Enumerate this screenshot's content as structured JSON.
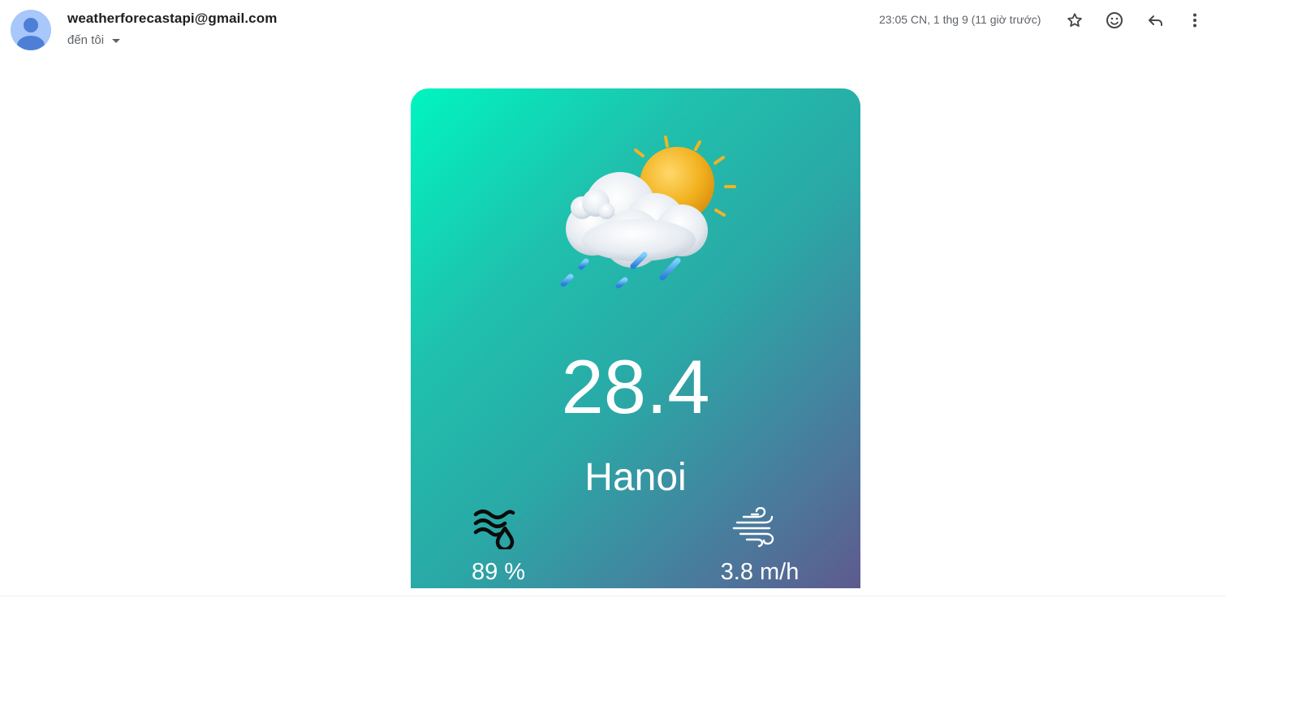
{
  "email": {
    "sender": "weatherforecastapi@gmail.com",
    "recipient_label": "đến tôi",
    "timestamp": "23:05 CN, 1 thg 9 (11 giờ trước)",
    "avatar_icon": "default-user-avatar-icon",
    "actions": {
      "star_icon": "star-icon",
      "emoji_icon": "emoji-react-icon",
      "reply_icon": "reply-icon",
      "more_icon": "more-vert-icon"
    }
  },
  "weather_card": {
    "condition_icon": "sun-cloud-rain-icon",
    "temperature": "28.4",
    "city": "Hanoi",
    "humidity": {
      "icon": "humidity-icon",
      "value": "89 %"
    },
    "wind": {
      "icon": "wind-icon",
      "value": "3.8 m/h"
    },
    "gradient_colors": [
      "#00f5c0",
      "#2aa8a6",
      "#5e5a8e"
    ]
  }
}
